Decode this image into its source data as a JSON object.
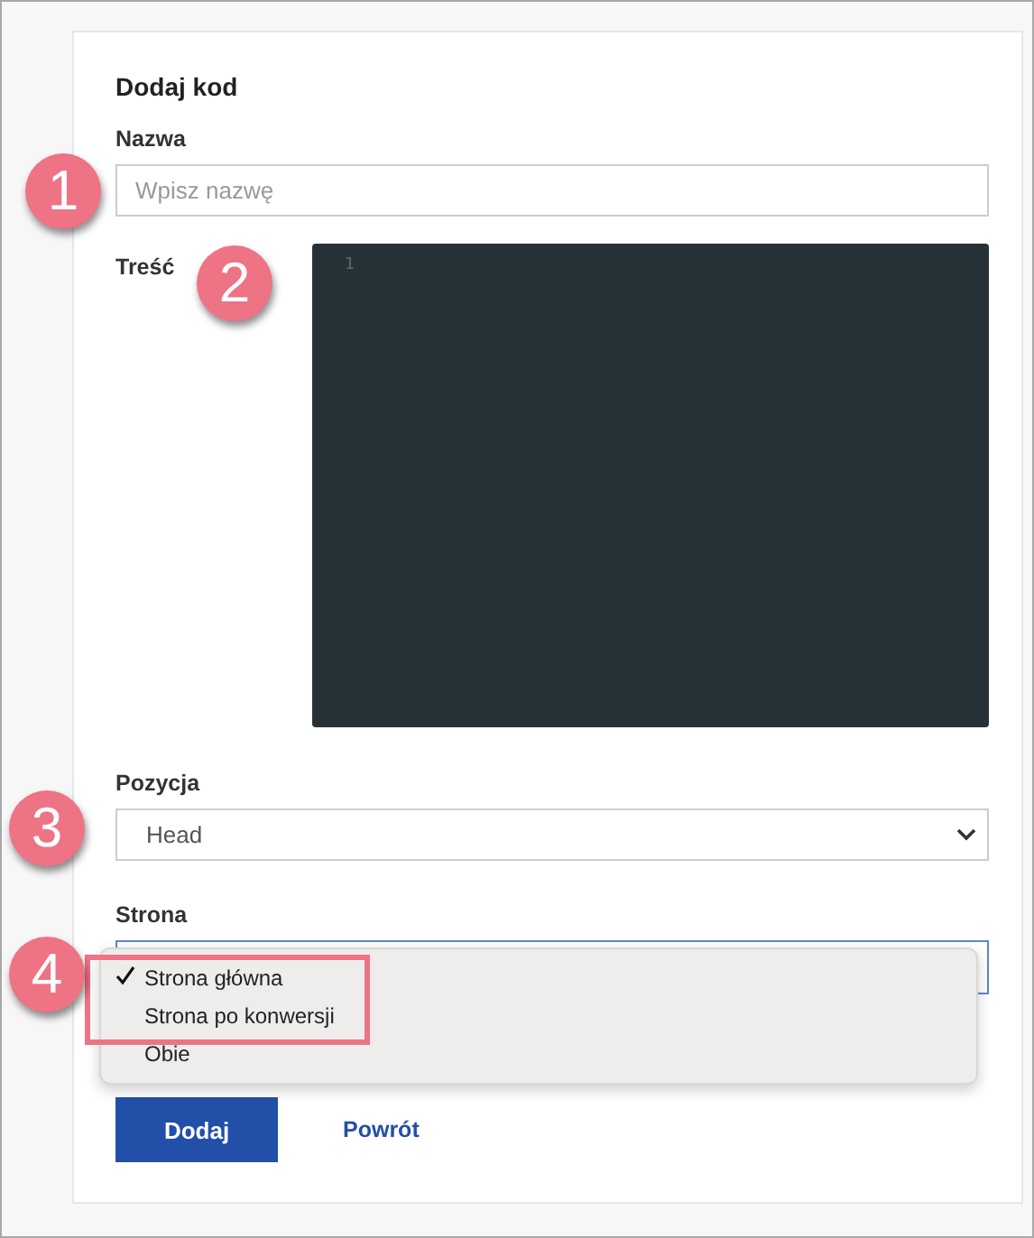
{
  "title": "Dodaj kod",
  "name_field": {
    "label": "Nazwa",
    "placeholder": "Wpisz nazwę"
  },
  "content_field": {
    "label": "Treść",
    "line_numbers": [
      "1"
    ]
  },
  "position_field": {
    "label": "Pozycja",
    "value": "Head"
  },
  "page_field": {
    "label": "Strona",
    "options": [
      {
        "label": "Strona główna",
        "selected": true
      },
      {
        "label": "Strona po konwersji",
        "selected": false
      },
      {
        "label": "Obie",
        "selected": false
      }
    ]
  },
  "buttons": {
    "primary": "Dodaj",
    "link": "Powrót"
  },
  "annotations": [
    "1",
    "2",
    "3",
    "4"
  ]
}
